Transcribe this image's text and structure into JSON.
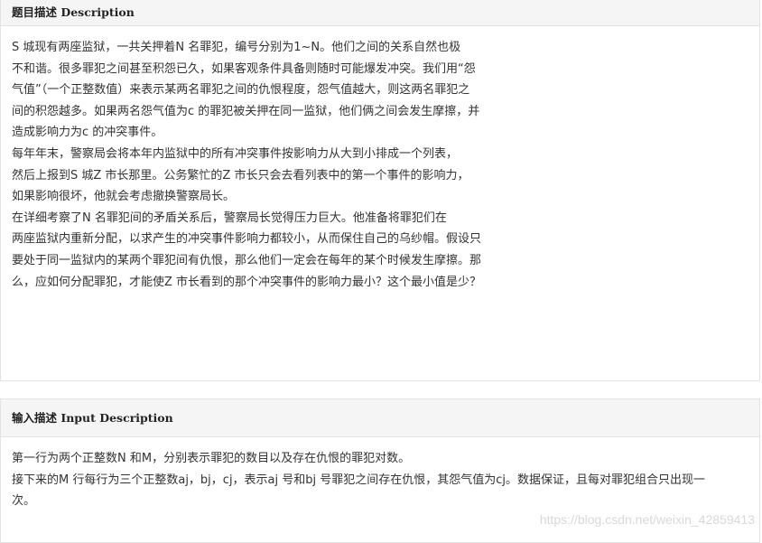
{
  "description": {
    "title_cn": "题目描述",
    "title_en": "Description",
    "lines": [
      "S 城现有两座监狱，一共关押着N 名罪犯，编号分别为1~N。他们之间的关系自然也极",
      "不和谐。很多罪犯之间甚至积怨已久，如果客观条件具备则随时可能爆发冲突。我们用“怨",
      "气值”（一个正整数值）来表示某两名罪犯之间的仇恨程度，怨气值越大，则这两名罪犯之",
      "间的积怨越多。如果两名怨气值为c 的罪犯被关押在同一监狱，他们俩之间会发生摩擦，并",
      "造成影响力为c 的冲突事件。",
      "每年年末，警察局会将本年内监狱中的所有冲突事件按影响力从大到小排成一个列表，",
      "然后上报到S 城Z 市长那里。公务繁忙的Z 市长只会去看列表中的第一个事件的影响力，",
      "如果影响很坏，他就会考虑撤换警察局长。",
      "在详细考察了N 名罪犯间的矛盾关系后，警察局长觉得压力巨大。他准备将罪犯们在",
      "两座监狱内重新分配，以求产生的冲突事件影响力都较小，从而保住自己的乌纱帽。假设只",
      "要处于同一监狱内的某两个罪犯间有仇恨，那么他们一定会在每年的某个时候发生摩擦。那",
      "么，应如何分配罪犯，才能使Z 市长看到的那个冲突事件的影响力最小？这个最小值是少？"
    ]
  },
  "input": {
    "title_cn": "输入描述",
    "title_en": "Input Description",
    "lines": [
      "第一行为两个正整数N 和M，分别表示罪犯的数目以及存在仇恨的罪犯对数。",
      "接下来的M 行每行为三个正整数aj，bj，cj，表示aj 号和bj 号罪犯之间存在仇恨，其怨气值为cj。数据保证，且每对罪犯组合只出现一",
      "次。"
    ]
  },
  "watermark": "https://blog.csdn.net/weixin_42859413"
}
